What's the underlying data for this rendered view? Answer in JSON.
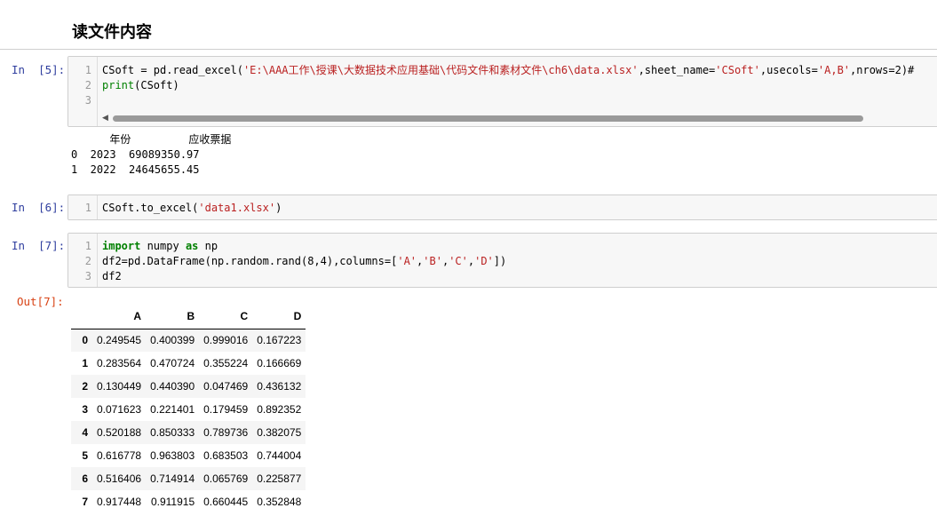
{
  "heading": "读文件内容",
  "cells": [
    {
      "prompt": "In  [5]:",
      "line_numbers": [
        "1",
        "2",
        "3"
      ],
      "code_lines": [
        [
          {
            "t": "CSoft = pd.read_excel(",
            "c": ""
          },
          {
            "t": "'E:\\AAA工作\\授课\\大数据技术应用基础\\代码文件和素材文件\\ch6\\data.xlsx'",
            "c": "str"
          },
          {
            "t": ",sheet_name=",
            "c": ""
          },
          {
            "t": "'CSoft'",
            "c": "str"
          },
          {
            "t": ",usecols=",
            "c": ""
          },
          {
            "t": "'A,B'",
            "c": "str"
          },
          {
            "t": ",nrows=2)#",
            "c": ""
          }
        ],
        [
          {
            "t": "print",
            "c": "bi"
          },
          {
            "t": "(CSoft)",
            "c": ""
          }
        ],
        []
      ],
      "output_lines": [
        "      年份         应收票据",
        "0  2023  69089350.97",
        "1  2022  24645655.45"
      ]
    },
    {
      "prompt": "In  [6]:",
      "line_numbers": [
        "1"
      ],
      "code_lines": [
        [
          {
            "t": "CSoft.to_excel(",
            "c": ""
          },
          {
            "t": "'data1.xlsx'",
            "c": "str"
          },
          {
            "t": ")",
            "c": ""
          }
        ]
      ]
    },
    {
      "prompt": "In  [7]:",
      "line_numbers": [
        "1",
        "2",
        "3"
      ],
      "code_lines": [
        [
          {
            "t": "import",
            "c": "kw"
          },
          {
            "t": " numpy ",
            "c": ""
          },
          {
            "t": "as",
            "c": "kw"
          },
          {
            "t": " np",
            "c": ""
          }
        ],
        [
          {
            "t": "df2=pd.DataFrame(np.random.rand(8,4),columns=[",
            "c": ""
          },
          {
            "t": "'A'",
            "c": "str"
          },
          {
            "t": ",",
            "c": ""
          },
          {
            "t": "'B'",
            "c": "str"
          },
          {
            "t": ",",
            "c": ""
          },
          {
            "t": "'C'",
            "c": "str"
          },
          {
            "t": ",",
            "c": ""
          },
          {
            "t": "'D'",
            "c": "str"
          },
          {
            "t": "])",
            "c": ""
          }
        ],
        [
          {
            "t": "df2",
            "c": ""
          }
        ]
      ]
    }
  ],
  "out_prompt": "Out[7]:",
  "dataframe": {
    "columns": [
      "",
      "A",
      "B",
      "C",
      "D"
    ],
    "rows": [
      [
        "0",
        "0.249545",
        "0.400399",
        "0.999016",
        "0.167223"
      ],
      [
        "1",
        "0.283564",
        "0.470724",
        "0.355224",
        "0.166669"
      ],
      [
        "2",
        "0.130449",
        "0.440390",
        "0.047469",
        "0.436132"
      ],
      [
        "3",
        "0.071623",
        "0.221401",
        "0.179459",
        "0.892352"
      ],
      [
        "4",
        "0.520188",
        "0.850333",
        "0.789736",
        "0.382075"
      ],
      [
        "5",
        "0.616778",
        "0.963803",
        "0.683503",
        "0.744004"
      ],
      [
        "6",
        "0.516406",
        "0.714914",
        "0.065769",
        "0.225877"
      ],
      [
        "7",
        "0.917448",
        "0.911915",
        "0.660445",
        "0.352848"
      ]
    ]
  },
  "colors": {
    "in_prompt": "#303f9f",
    "out_prompt": "#d84315",
    "string": "#ba2121",
    "keyword": "#008000",
    "cell_bg": "#f7f7f7"
  },
  "icons": {
    "scroll_left": "scroll-left-arrow-icon"
  }
}
